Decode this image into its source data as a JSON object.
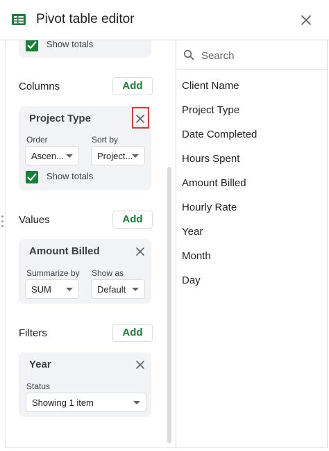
{
  "header": {
    "title": "Pivot table editor",
    "close_icon": "close-icon",
    "sheet_icon": "sheets-table-icon",
    "accent": "#188038"
  },
  "rows_tail": {
    "show_totals_label": "Show totals",
    "show_totals_checked": true
  },
  "columns": {
    "label": "Columns",
    "add_label": "Add",
    "card": {
      "title": "Project Type",
      "order_label": "Order",
      "order_value": "Ascen...",
      "sort_by_label": "Sort by",
      "sort_by_value": "Project...",
      "show_totals_label": "Show totals",
      "show_totals_checked": true,
      "close_highlight_color": "#e53935"
    }
  },
  "values": {
    "label": "Values",
    "add_label": "Add",
    "card": {
      "title": "Amount Billed",
      "summarize_label": "Summarize by",
      "summarize_value": "SUM",
      "show_as_label": "Show as",
      "show_as_value": "Default"
    }
  },
  "filters": {
    "label": "Filters",
    "add_label": "Add",
    "card": {
      "title": "Year",
      "status_label": "Status",
      "status_value": "Showing 1 item"
    }
  },
  "search": {
    "placeholder": "Search",
    "icon": "search-icon"
  },
  "fields": [
    "Client Name",
    "Project Type",
    "Date Completed",
    "Hours Spent",
    "Amount Billed",
    "Hourly Rate",
    "Year",
    "Month",
    "Day"
  ]
}
